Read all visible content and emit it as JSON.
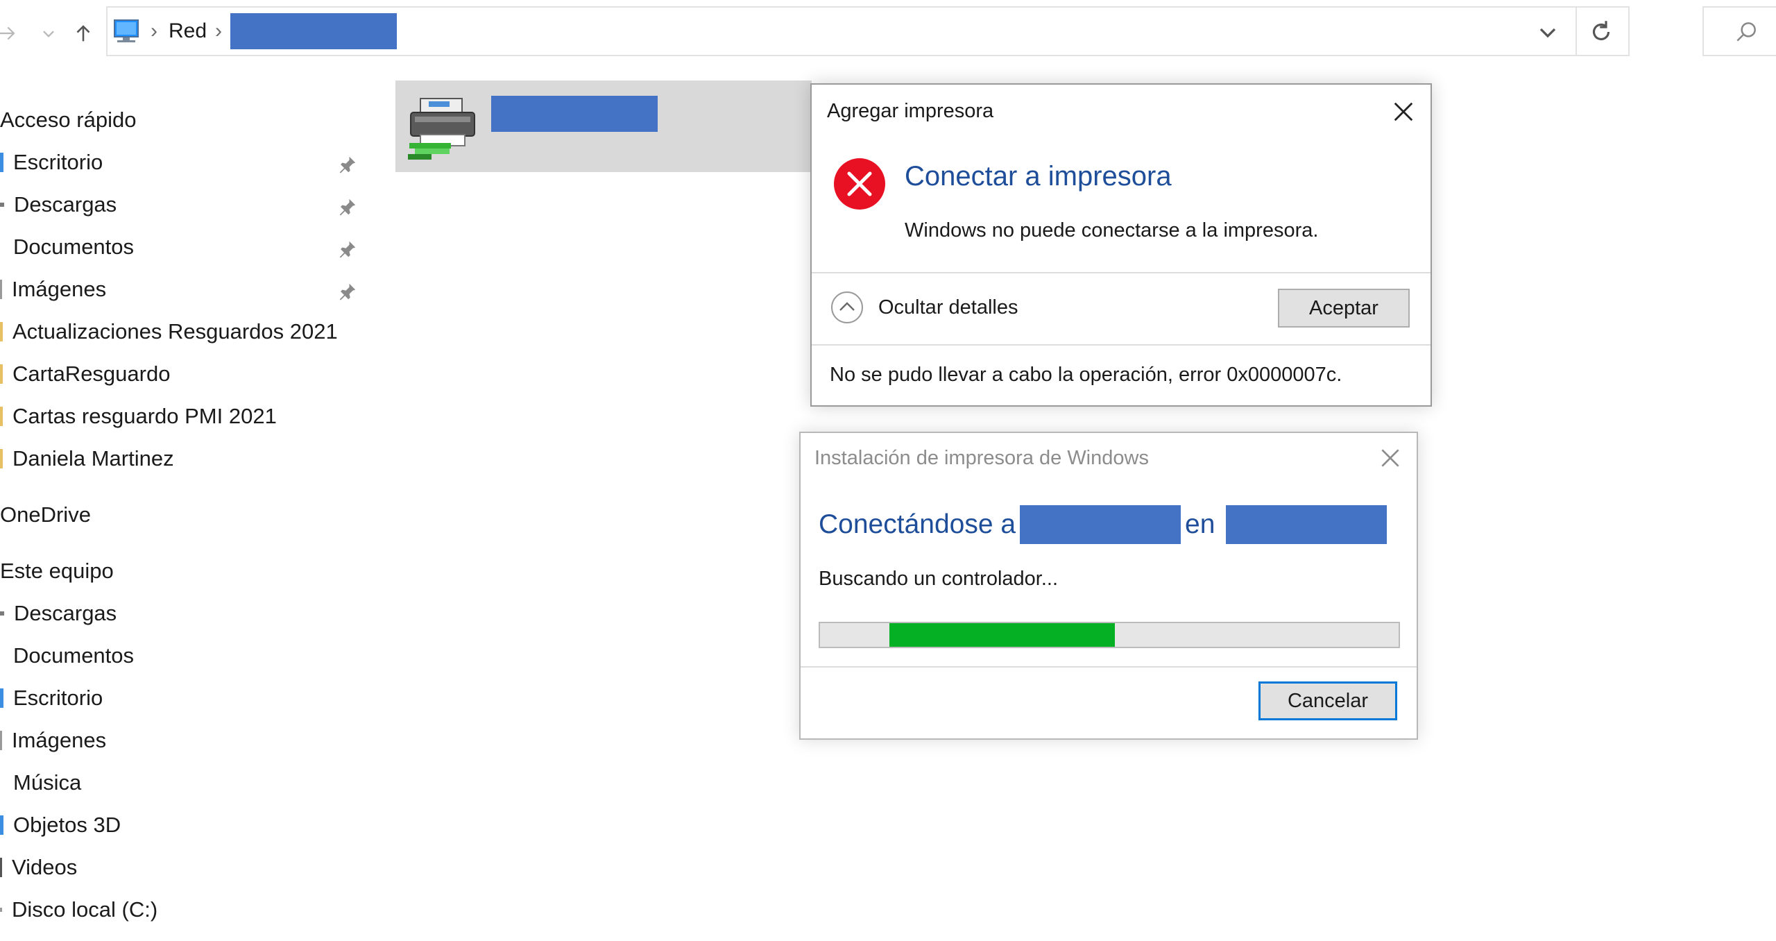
{
  "address_bar": {
    "breadcrumbs": [
      "Red"
    ],
    "icons": [
      "forward-arrow-icon",
      "recent-dropdown-icon",
      "up-arrow-icon",
      "computer-icon",
      "chevron-down-icon",
      "refresh-icon",
      "search-icon"
    ]
  },
  "sidebar": {
    "quick_access": {
      "label": "Acceso rápido",
      "items": [
        {
          "label": "Escritorio",
          "pinned": true
        },
        {
          "label": "Descargas",
          "pinned": true
        },
        {
          "label": "Documentos",
          "pinned": true
        },
        {
          "label": "Imágenes",
          "pinned": true
        },
        {
          "label": "Actualizaciones Resguardos 2021",
          "pinned": false
        },
        {
          "label": "CartaResguardo",
          "pinned": false
        },
        {
          "label": "Cartas resguardo PMI 2021",
          "pinned": false
        },
        {
          "label": "Daniela Martinez",
          "pinned": false
        }
      ]
    },
    "onedrive": {
      "label": "OneDrive"
    },
    "this_pc": {
      "label": "Este equipo",
      "items": [
        {
          "label": "Descargas"
        },
        {
          "label": "Documentos"
        },
        {
          "label": "Escritorio"
        },
        {
          "label": "Imágenes"
        },
        {
          "label": "Música"
        },
        {
          "label": "Objetos 3D"
        },
        {
          "label": "Videos"
        },
        {
          "label": "Disco local (C:)"
        }
      ]
    }
  },
  "dialog_add_printer": {
    "title": "Agregar impresora",
    "heading": "Conectar a impresora",
    "message": "Windows no puede conectarse a la impresora.",
    "details_toggle": "Ocultar detalles",
    "ok_button": "Aceptar",
    "error_detail": "No se pudo llevar a cabo la operación, error 0x0000007c."
  },
  "dialog_install": {
    "title": "Instalación de impresora de Windows",
    "heading_prefix": "Conectándose a",
    "heading_middle": "en",
    "status": "Buscando un controlador...",
    "progress_start": 0.12,
    "progress_end": 0.51,
    "cancel_button": "Cancelar"
  },
  "colors": {
    "redaction": "#4472c4",
    "heading_blue": "#1e4e9a",
    "progress_green": "#06b025",
    "error_red": "#e81123",
    "focus_blue": "#0078d7"
  }
}
